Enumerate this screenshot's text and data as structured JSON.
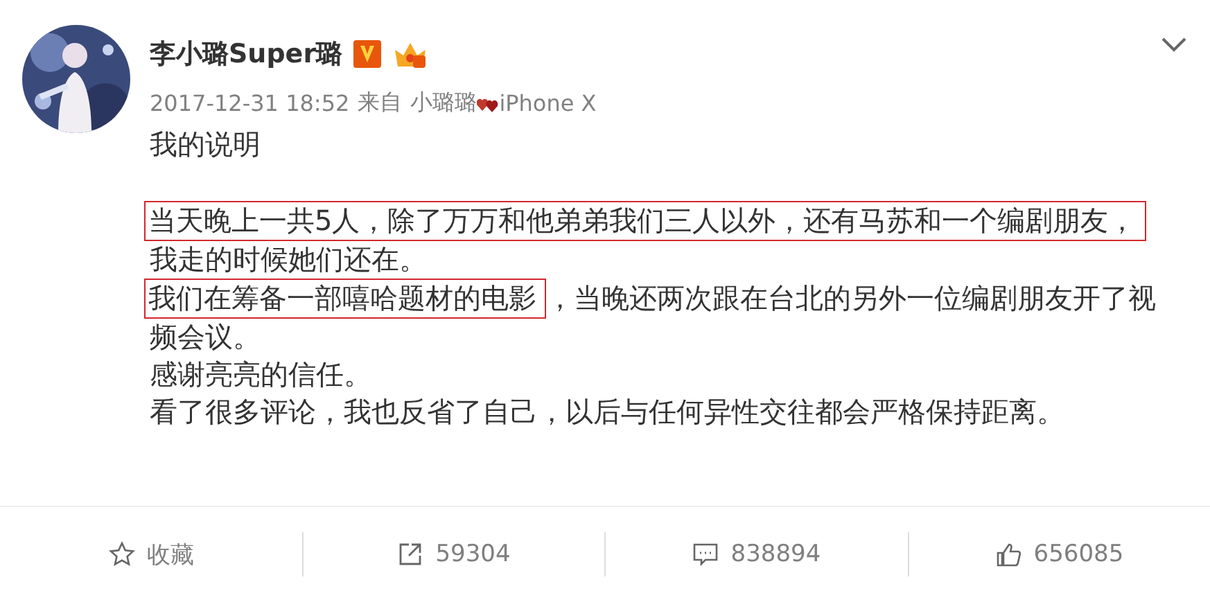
{
  "post": {
    "author": "李小璐Super璐",
    "time": "2017-12-31 18:52",
    "source_prefix": "来自",
    "source_name": "小璐璐",
    "source_device": "iPhone X",
    "paragraphs": [
      {
        "segments": [
          {
            "text": "我的说明",
            "highlighted": false
          }
        ]
      },
      {
        "segments": [
          {
            "text": "当天晚上一共5人，除了万万和他弟弟我们三人以外，还有马苏和一个编剧朋友，",
            "highlighted": true
          },
          {
            "text": "我走的时候她们还在。",
            "highlighted": false
          }
        ]
      },
      {
        "segments": [
          {
            "text": "我们在筹备一部嘻哈题材的电影",
            "highlighted": true
          },
          {
            "text": "，当晚还两次跟在台北的另外一位编剧朋友开了视频会议。",
            "highlighted": false
          }
        ]
      },
      {
        "segments": [
          {
            "text": "感谢亮亮的信任。",
            "highlighted": false
          }
        ]
      },
      {
        "segments": [
          {
            "text": "看了很多评论，我也反省了自己，以后与任何异性交往都会严格保持距离。",
            "highlighted": false
          }
        ]
      }
    ]
  },
  "actions": [
    {
      "kind": "favorite",
      "label": "收藏"
    },
    {
      "kind": "repost",
      "label": "59304"
    },
    {
      "kind": "comment",
      "label": "838894"
    },
    {
      "kind": "like",
      "label": "656085"
    }
  ]
}
